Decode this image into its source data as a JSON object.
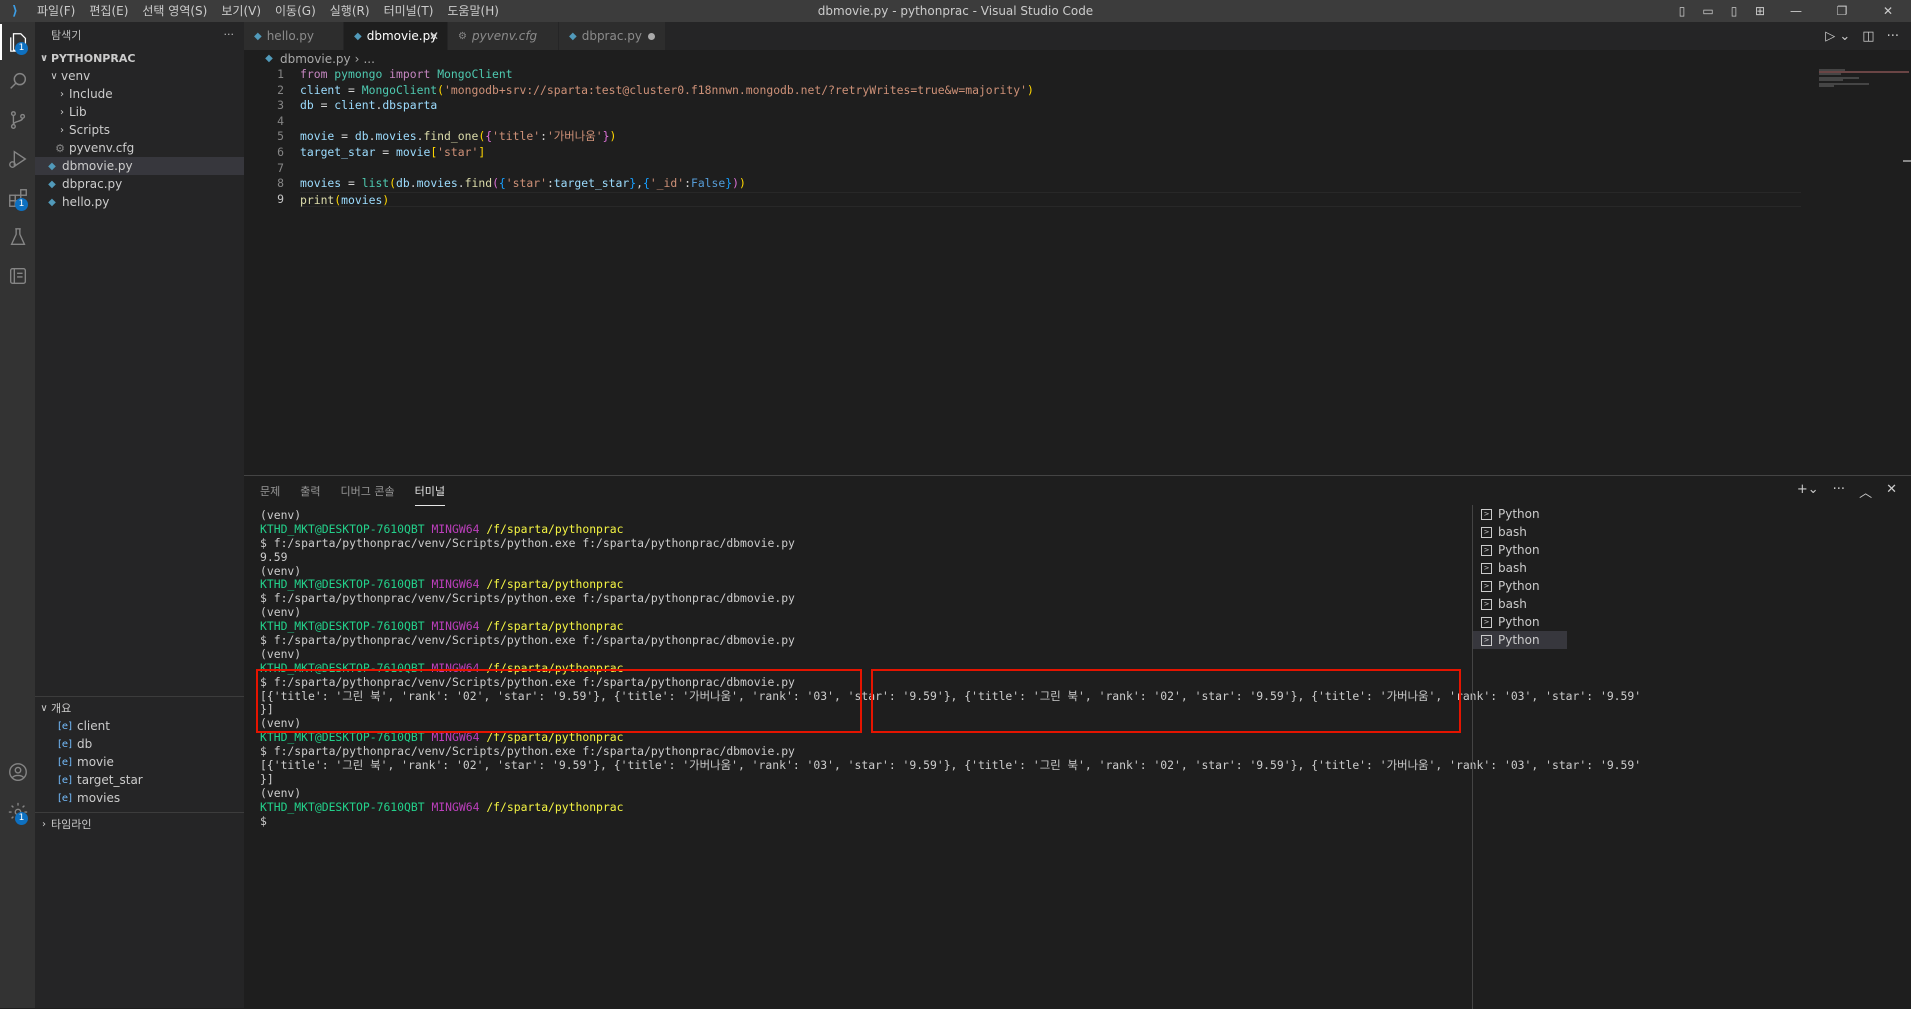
{
  "titlebar": {
    "logo": "⟩",
    "menu": [
      "파일(F)",
      "편집(E)",
      "선택 영역(S)",
      "보기(V)",
      "이동(G)",
      "실행(R)",
      "터미널(T)",
      "도움말(H)"
    ],
    "title": "dbmovie.py - pythonprac - Visual Studio Code"
  },
  "activity": {
    "explorer_badge": "1",
    "extensions_badge": "1",
    "settings_badge": "1"
  },
  "sidebar": {
    "header": "탐색기",
    "more": "···",
    "root": "PYTHONPRAC",
    "tree": [
      {
        "label": "venv",
        "chev": "∨"
      },
      {
        "label": "Include",
        "chev": "›"
      },
      {
        "label": "Lib",
        "chev": "›"
      },
      {
        "label": "Scripts",
        "chev": "›"
      },
      {
        "label": "pyvenv.cfg",
        "icon": "⚙"
      },
      {
        "label": "dbmovie.py",
        "icon": "◆"
      },
      {
        "label": "dbprac.py",
        "icon": "◆"
      },
      {
        "label": "hello.py",
        "icon": "◆"
      }
    ],
    "outline_header": "개요",
    "outline": [
      "client",
      "db",
      "movie",
      "target_star",
      "movies"
    ],
    "timeline_header": "타임라인"
  },
  "tabs": [
    {
      "label": "hello.py"
    },
    {
      "label": "dbmovie.py"
    },
    {
      "label": "pyvenv.cfg"
    },
    {
      "label": "dbprac.py"
    }
  ],
  "breadcrumb": {
    "file": "dbmovie.py",
    "sep": "›",
    "rest": "..."
  },
  "editor": {
    "line_numbers": [
      "1",
      "2",
      "3",
      "4",
      "5",
      "6",
      "7",
      "8",
      "9"
    ],
    "current_line": 9
  },
  "panel": {
    "tabs": [
      "문제",
      "출력",
      "디버그 콘솔",
      "터미널"
    ],
    "active_tab": "터미널",
    "user_host": "KTHD_MKT@DESKTOP-7610QBT",
    "shell": "MINGW64",
    "cwd": "/f/sparta/pythonprac",
    "venv": "(venv)",
    "cmd": "$ f:/sparta/pythonprac/venv/Scripts/python.exe f:/sparta/pythonprac/dbmovie.py",
    "out_star": "9.59",
    "out_list_a": "[{'title': '그린 북', 'rank': '02', 'star': '9.59'}, {'title': '가버나움', 'rank': '03', 'star': '9.59'},",
    "out_list_b": " {'title': '그린 북', 'rank': '02', 'star': '9.59'}, {'title': '가버나움', 'rank': '03', 'star': '9.59'",
    "out_close": "}]",
    "prompt": "$",
    "terminals": [
      "Python",
      "bash",
      "Python",
      "bash",
      "Python",
      "bash",
      "Python",
      "Python"
    ]
  },
  "colors": {
    "accent": "#0e70c0",
    "highlight_box": "#e51400"
  }
}
